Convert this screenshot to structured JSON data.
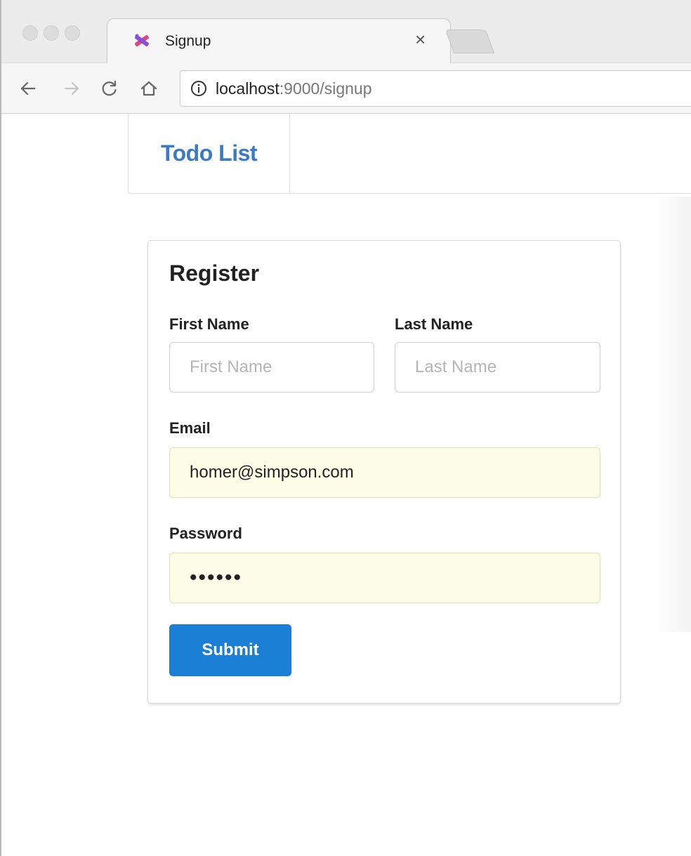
{
  "browser": {
    "tab": {
      "title": "Signup",
      "close_glyph": "×",
      "favicon": "app-favicon-icon"
    },
    "address_bar": {
      "host": "localhost",
      "rest": ":9000/signup"
    },
    "icons": {
      "back": "arrow-left-icon",
      "forward": "arrow-right-icon",
      "reload": "reload-icon",
      "home": "home-icon",
      "info": "info-icon"
    }
  },
  "navbar": {
    "brand": "Todo List"
  },
  "form": {
    "title": "Register",
    "first_name": {
      "label": "First Name",
      "placeholder": "First Name",
      "value": ""
    },
    "last_name": {
      "label": "Last Name",
      "placeholder": "Last Name",
      "value": ""
    },
    "email": {
      "label": "Email",
      "value": "homer@simpson.com"
    },
    "password": {
      "label": "Password",
      "value": "secret"
    },
    "submit_label": "Submit"
  },
  "colors": {
    "brand": "#3b7ac4",
    "primary_button": "#1c7fd6",
    "autofill_bg": "#fefee8"
  }
}
